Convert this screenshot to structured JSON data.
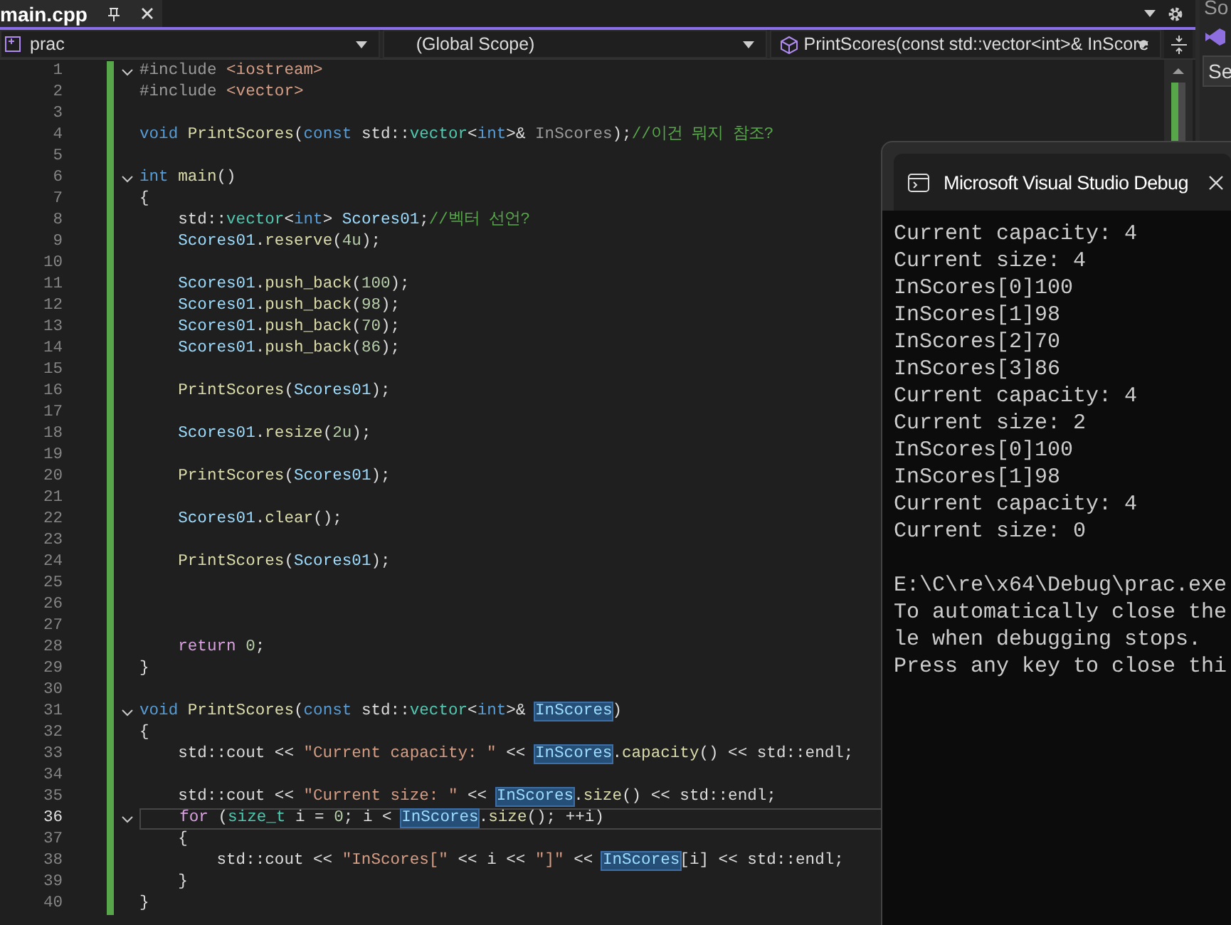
{
  "tab": {
    "label": "main.cpp"
  },
  "navbar": {
    "project": "prac",
    "scope": "(Global Scope)",
    "member": "PrintScores(const std::vector<int>& InScore"
  },
  "editor": {
    "lines": [
      {
        "number": "1",
        "fold": true,
        "current": false,
        "tokens": [
          {
            "kind": "pre",
            "text": "#include "
          },
          {
            "kind": "string",
            "text": "<iostream>"
          }
        ]
      },
      {
        "number": "2",
        "fold": false,
        "current": false,
        "tokens": [
          {
            "kind": "pre",
            "text": "#include "
          },
          {
            "kind": "string",
            "text": "<vector>"
          }
        ]
      },
      {
        "number": "3",
        "fold": false,
        "current": false
      },
      {
        "number": "4",
        "fold": false,
        "current": false,
        "tokens": [
          {
            "kind": "keyword",
            "text": "void "
          },
          {
            "kind": "function",
            "text": "PrintScores"
          },
          {
            "kind": "plain",
            "text": "("
          },
          {
            "kind": "keyword",
            "text": "const"
          },
          {
            "kind": "plain",
            "text": " std::"
          },
          {
            "kind": "type",
            "text": "vector"
          },
          {
            "kind": "plain",
            "text": "<"
          },
          {
            "kind": "keyword",
            "text": "int"
          },
          {
            "kind": "plain",
            "text": ">& "
          },
          {
            "kind": "param",
            "text": "InScores"
          },
          {
            "kind": "plain",
            "text": ");"
          },
          {
            "kind": "comment",
            "text": "//이건 뭐지 참조?"
          }
        ]
      },
      {
        "number": "5",
        "fold": false,
        "current": false
      },
      {
        "number": "6",
        "fold": true,
        "current": false,
        "tokens": [
          {
            "kind": "keyword",
            "text": "int "
          },
          {
            "kind": "function",
            "text": "main"
          },
          {
            "kind": "plain",
            "text": "()"
          }
        ]
      },
      {
        "number": "7",
        "fold": false,
        "current": false,
        "tokens": [
          {
            "kind": "plain",
            "text": "{"
          }
        ]
      },
      {
        "number": "8",
        "fold": false,
        "current": false,
        "tokens": [
          {
            "kind": "plain",
            "text": "    std::"
          },
          {
            "kind": "type",
            "text": "vector"
          },
          {
            "kind": "plain",
            "text": "<"
          },
          {
            "kind": "keyword",
            "text": "int"
          },
          {
            "kind": "plain",
            "text": "> "
          },
          {
            "kind": "variable",
            "text": "Scores01"
          },
          {
            "kind": "plain",
            "text": ";"
          },
          {
            "kind": "comment",
            "text": "//벡터 선언?"
          }
        ]
      },
      {
        "number": "9",
        "fold": false,
        "current": false,
        "tokens": [
          {
            "kind": "variable",
            "text": "    Scores01"
          },
          {
            "kind": "plain",
            "text": "."
          },
          {
            "kind": "function",
            "text": "reserve"
          },
          {
            "kind": "plain",
            "text": "("
          },
          {
            "kind": "number",
            "text": "4u"
          },
          {
            "kind": "plain",
            "text": ");"
          }
        ]
      },
      {
        "number": "10",
        "fold": false,
        "current": false
      },
      {
        "number": "11",
        "fold": false,
        "current": false,
        "tokens": [
          {
            "kind": "variable",
            "text": "    Scores01"
          },
          {
            "kind": "plain",
            "text": "."
          },
          {
            "kind": "function",
            "text": "push_back"
          },
          {
            "kind": "plain",
            "text": "("
          },
          {
            "kind": "number",
            "text": "100"
          },
          {
            "kind": "plain",
            "text": ");"
          }
        ]
      },
      {
        "number": "12",
        "fold": false,
        "current": false,
        "tokens": [
          {
            "kind": "variable",
            "text": "    Scores01"
          },
          {
            "kind": "plain",
            "text": "."
          },
          {
            "kind": "function",
            "text": "push_back"
          },
          {
            "kind": "plain",
            "text": "("
          },
          {
            "kind": "number",
            "text": "98"
          },
          {
            "kind": "plain",
            "text": ");"
          }
        ]
      },
      {
        "number": "13",
        "fold": false,
        "current": false,
        "tokens": [
          {
            "kind": "variable",
            "text": "    Scores01"
          },
          {
            "kind": "plain",
            "text": "."
          },
          {
            "kind": "function",
            "text": "push_back"
          },
          {
            "kind": "plain",
            "text": "("
          },
          {
            "kind": "number",
            "text": "70"
          },
          {
            "kind": "plain",
            "text": ");"
          }
        ]
      },
      {
        "number": "14",
        "fold": false,
        "current": false,
        "tokens": [
          {
            "kind": "variable",
            "text": "    Scores01"
          },
          {
            "kind": "plain",
            "text": "."
          },
          {
            "kind": "function",
            "text": "push_back"
          },
          {
            "kind": "plain",
            "text": "("
          },
          {
            "kind": "number",
            "text": "86"
          },
          {
            "kind": "plain",
            "text": ");"
          }
        ]
      },
      {
        "number": "15",
        "fold": false,
        "current": false
      },
      {
        "number": "16",
        "fold": false,
        "current": false,
        "tokens": [
          {
            "kind": "function",
            "text": "    PrintScores"
          },
          {
            "kind": "plain",
            "text": "("
          },
          {
            "kind": "variable",
            "text": "Scores01"
          },
          {
            "kind": "plain",
            "text": ");"
          }
        ]
      },
      {
        "number": "17",
        "fold": false,
        "current": false
      },
      {
        "number": "18",
        "fold": false,
        "current": false,
        "tokens": [
          {
            "kind": "variable",
            "text": "    Scores01"
          },
          {
            "kind": "plain",
            "text": "."
          },
          {
            "kind": "function",
            "text": "resize"
          },
          {
            "kind": "plain",
            "text": "("
          },
          {
            "kind": "number",
            "text": "2u"
          },
          {
            "kind": "plain",
            "text": ");"
          }
        ]
      },
      {
        "number": "19",
        "fold": false,
        "current": false
      },
      {
        "number": "20",
        "fold": false,
        "current": false,
        "tokens": [
          {
            "kind": "function",
            "text": "    PrintScores"
          },
          {
            "kind": "plain",
            "text": "("
          },
          {
            "kind": "variable",
            "text": "Scores01"
          },
          {
            "kind": "plain",
            "text": ");"
          }
        ]
      },
      {
        "number": "21",
        "fold": false,
        "current": false
      },
      {
        "number": "22",
        "fold": false,
        "current": false,
        "tokens": [
          {
            "kind": "variable",
            "text": "    Scores01"
          },
          {
            "kind": "plain",
            "text": "."
          },
          {
            "kind": "function",
            "text": "clear"
          },
          {
            "kind": "plain",
            "text": "();"
          }
        ]
      },
      {
        "number": "23",
        "fold": false,
        "current": false
      },
      {
        "number": "24",
        "fold": false,
        "current": false,
        "tokens": [
          {
            "kind": "function",
            "text": "    PrintScores"
          },
          {
            "kind": "plain",
            "text": "("
          },
          {
            "kind": "variable",
            "text": "Scores01"
          },
          {
            "kind": "plain",
            "text": ");"
          }
        ]
      },
      {
        "number": "25",
        "fold": false,
        "current": false
      },
      {
        "number": "26",
        "fold": false,
        "current": false
      },
      {
        "number": "27",
        "fold": false,
        "current": false
      },
      {
        "number": "28",
        "fold": false,
        "current": false,
        "tokens": [
          {
            "kind": "control",
            "text": "    return "
          },
          {
            "kind": "number",
            "text": "0"
          },
          {
            "kind": "plain",
            "text": ";"
          }
        ]
      },
      {
        "number": "29",
        "fold": false,
        "current": false,
        "tokens": [
          {
            "kind": "plain",
            "text": "}"
          }
        ]
      },
      {
        "number": "30",
        "fold": false,
        "current": false
      },
      {
        "number": "31",
        "fold": true,
        "current": false,
        "tokens": [
          {
            "kind": "keyword",
            "text": "void "
          },
          {
            "kind": "function",
            "text": "PrintScores"
          },
          {
            "kind": "plain",
            "text": "("
          },
          {
            "kind": "keyword",
            "text": "const"
          },
          {
            "kind": "plain",
            "text": " std::"
          },
          {
            "kind": "type",
            "text": "vector"
          },
          {
            "kind": "plain",
            "text": "<"
          },
          {
            "kind": "keyword",
            "text": "int"
          },
          {
            "kind": "plain",
            "text": ">& "
          },
          {
            "kind": "highlight",
            "text": "InScores"
          },
          {
            "kind": "plain",
            "text": ")"
          }
        ]
      },
      {
        "number": "32",
        "fold": false,
        "current": false,
        "tokens": [
          {
            "kind": "plain",
            "text": "{"
          }
        ]
      },
      {
        "number": "33",
        "fold": false,
        "current": false,
        "tokens": [
          {
            "kind": "plain",
            "text": "    std::cout << "
          },
          {
            "kind": "string",
            "text": "\"Current capacity: \""
          },
          {
            "kind": "plain",
            "text": " << "
          },
          {
            "kind": "highlight",
            "text": "InScores"
          },
          {
            "kind": "plain",
            "text": "."
          },
          {
            "kind": "function",
            "text": "capacity"
          },
          {
            "kind": "plain",
            "text": "() << std::endl;"
          }
        ]
      },
      {
        "number": "34",
        "fold": false,
        "current": false
      },
      {
        "number": "35",
        "fold": false,
        "current": false,
        "tokens": [
          {
            "kind": "plain",
            "text": "    std::cout << "
          },
          {
            "kind": "string",
            "text": "\"Current size: \""
          },
          {
            "kind": "plain",
            "text": " << "
          },
          {
            "kind": "highlight",
            "text": "InScores"
          },
          {
            "kind": "plain",
            "text": "."
          },
          {
            "kind": "function",
            "text": "size"
          },
          {
            "kind": "plain",
            "text": "() << std::endl;"
          }
        ]
      },
      {
        "number": "36",
        "fold": true,
        "current": true,
        "tokens": [
          {
            "kind": "control",
            "text": "    for"
          },
          {
            "kind": "plain",
            "text": " ("
          },
          {
            "kind": "type",
            "text": "size_t"
          },
          {
            "kind": "plain",
            "text": " i = "
          },
          {
            "kind": "number",
            "text": "0"
          },
          {
            "kind": "plain",
            "text": "; i < "
          },
          {
            "kind": "highlight",
            "text": "InScores"
          },
          {
            "kind": "plain",
            "text": "."
          },
          {
            "kind": "function",
            "text": "size"
          },
          {
            "kind": "plain",
            "text": "(); ++i)"
          }
        ]
      },
      {
        "number": "37",
        "fold": false,
        "current": false,
        "tokens": [
          {
            "kind": "plain",
            "text": "    {"
          }
        ]
      },
      {
        "number": "38",
        "fold": false,
        "current": false,
        "tokens": [
          {
            "kind": "plain",
            "text": "        std::cout << "
          },
          {
            "kind": "string",
            "text": "\"InScores[\""
          },
          {
            "kind": "plain",
            "text": " << i << "
          },
          {
            "kind": "string",
            "text": "\"]\""
          },
          {
            "kind": "plain",
            "text": " << "
          },
          {
            "kind": "highlight",
            "text": "InScores"
          },
          {
            "kind": "plain",
            "text": "[i] << std::endl;"
          }
        ]
      },
      {
        "number": "39",
        "fold": false,
        "current": false,
        "tokens": [
          {
            "kind": "plain",
            "text": "    }"
          }
        ]
      },
      {
        "number": "40",
        "fold": false,
        "current": false,
        "tokens": [
          {
            "kind": "plain",
            "text": "}"
          }
        ]
      }
    ]
  },
  "console": {
    "title": "Microsoft Visual Studio Debug",
    "output": [
      "Current capacity: 4",
      "Current size: 4",
      "InScores[0]100",
      "InScores[1]98",
      "InScores[2]70",
      "InScores[3]86",
      "Current capacity: 4",
      "Current size: 2",
      "InScores[0]100",
      "InScores[1]98",
      "Current capacity: 4",
      "Current size: 0"
    ],
    "messages": [
      "E:\\C\\re\\x64\\Debug\\prac.exe",
      "To automatically close the",
      "le when debugging stops.",
      "Press any key to close thi"
    ]
  },
  "side_panel": {
    "title": "So",
    "button": "Se"
  }
}
